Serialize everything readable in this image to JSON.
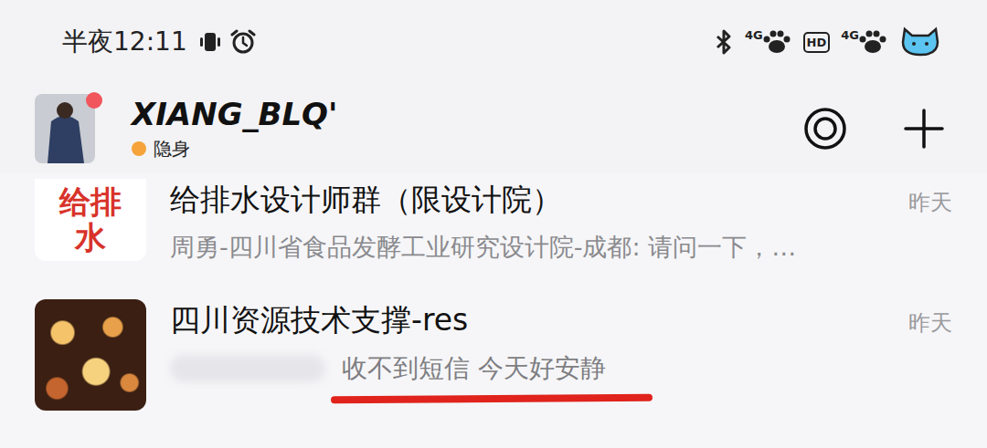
{
  "status_bar": {
    "time": "半夜12:11",
    "network": [
      "4G",
      "4G"
    ],
    "hd": "HD"
  },
  "header": {
    "name": "XIANG_BLQ'",
    "status": "隐身",
    "has_unread": true
  },
  "conversations": [
    {
      "kind": "text-avatar",
      "avatar_text": "给排水",
      "title": "给排水设计师群（限设计院）",
      "preview": "周勇-四川省食品发酵工业研究设计院-成都: 请问一下，…",
      "time": "昨天",
      "highlighted": false
    },
    {
      "kind": "photo-avatar",
      "avatar_text": "",
      "title": "四川资源技术支撑-res",
      "preview": "收不到短信 今天好安静",
      "time": "昨天",
      "highlighted": true
    }
  ]
}
